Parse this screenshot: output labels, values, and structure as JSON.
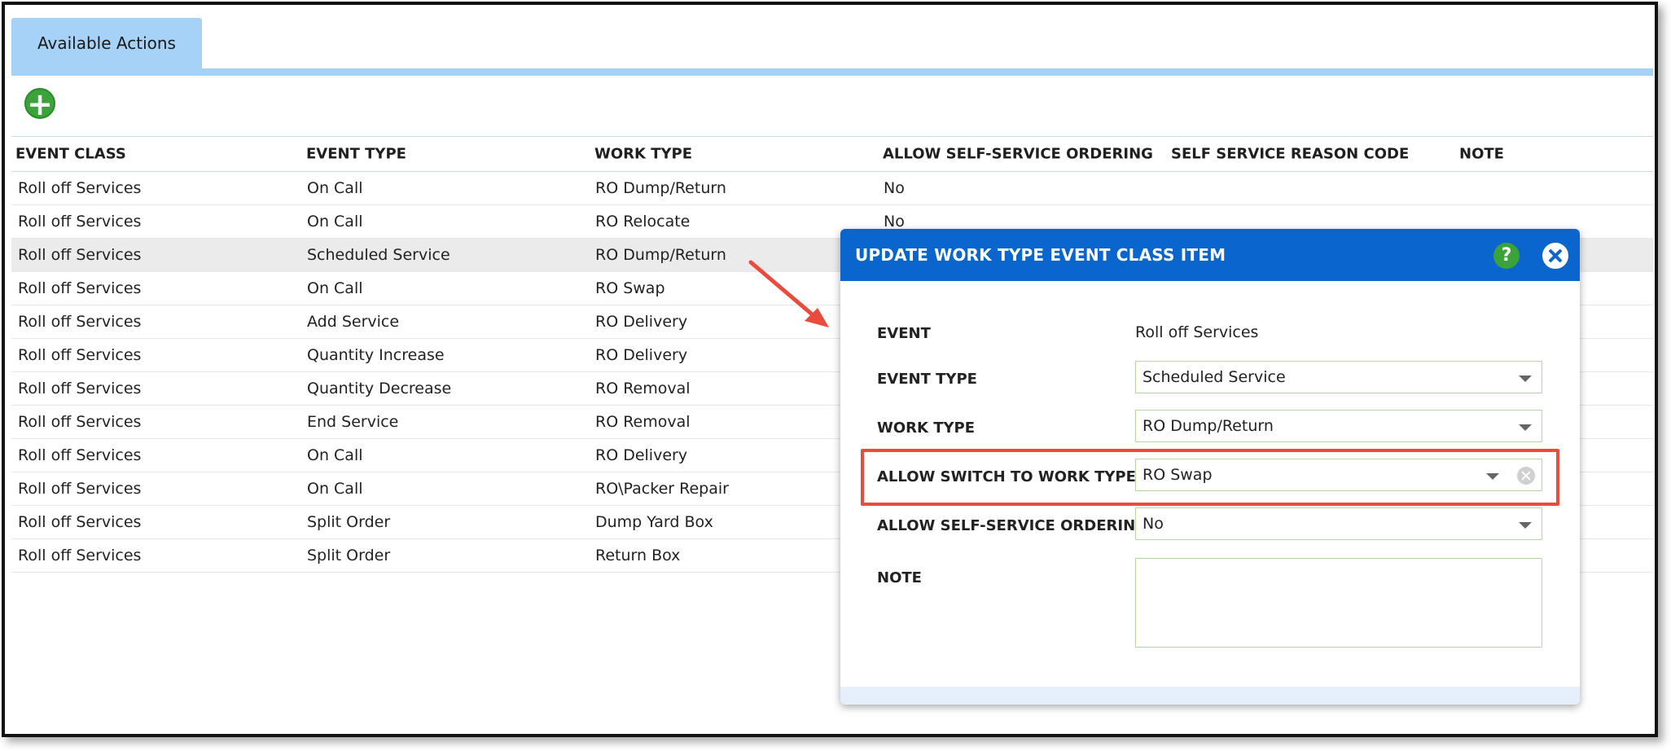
{
  "tabs": [
    {
      "label": "Available Actions"
    }
  ],
  "toolbar": {
    "add_icon": "plus-circle-icon"
  },
  "table": {
    "columns": [
      "EVENT CLASS",
      "EVENT TYPE",
      "WORK TYPE",
      "ALLOW SELF-SERVICE ORDERING",
      "SELF SERVICE REASON CODE",
      "NOTE"
    ],
    "rows": [
      [
        "Roll off Services",
        "On Call",
        "RO Dump/Return",
        "No",
        "",
        ""
      ],
      [
        "Roll off Services",
        "On Call",
        "RO Relocate",
        "No",
        "",
        ""
      ],
      [
        "Roll off Services",
        "Scheduled Service",
        "RO Dump/Return",
        "",
        "",
        ""
      ],
      [
        "Roll off Services",
        "On Call",
        "RO Swap",
        "",
        "",
        ""
      ],
      [
        "Roll off Services",
        "Add Service",
        "RO Delivery",
        "",
        "",
        ""
      ],
      [
        "Roll off Services",
        "Quantity Increase",
        "RO Delivery",
        "",
        "",
        ""
      ],
      [
        "Roll off Services",
        "Quantity Decrease",
        "RO Removal",
        "",
        "",
        ""
      ],
      [
        "Roll off Services",
        "End Service",
        "RO Removal",
        "",
        "",
        ""
      ],
      [
        "Roll off Services",
        "On Call",
        "RO Delivery",
        "",
        "",
        ""
      ],
      [
        "Roll off Services",
        "On Call",
        "RO\\Packer Repair",
        "",
        "",
        ""
      ],
      [
        "Roll off Services",
        "Split Order",
        "Dump Yard Box",
        "",
        "",
        ""
      ],
      [
        "Roll off Services",
        "Split Order",
        "Return Box",
        "",
        "",
        ""
      ]
    ]
  },
  "dialog": {
    "title": "UPDATE WORK TYPE EVENT CLASS ITEM",
    "help_label": "?",
    "fields": {
      "event_label": "EVENT",
      "event_value": "Roll off Services",
      "event_type_label": "EVENT TYPE",
      "event_type_value": "Scheduled Service",
      "work_type_label": "WORK TYPE",
      "work_type_value": "RO Dump/Return",
      "allow_switch_label": "ALLOW SWITCH TO WORK TYPE",
      "allow_switch_value": "RO Swap",
      "self_service_label": "ALLOW SELF-SERVICE ORDERING",
      "self_service_value": "No",
      "note_label": "NOTE",
      "note_value": ""
    }
  },
  "annotation": {
    "arrow_color": "#e94b3c",
    "highlight_color": "#e94b3c"
  },
  "colors": {
    "accent": "#0a66cc",
    "tab": "#a7d2f7",
    "add": "#3aa33a"
  }
}
